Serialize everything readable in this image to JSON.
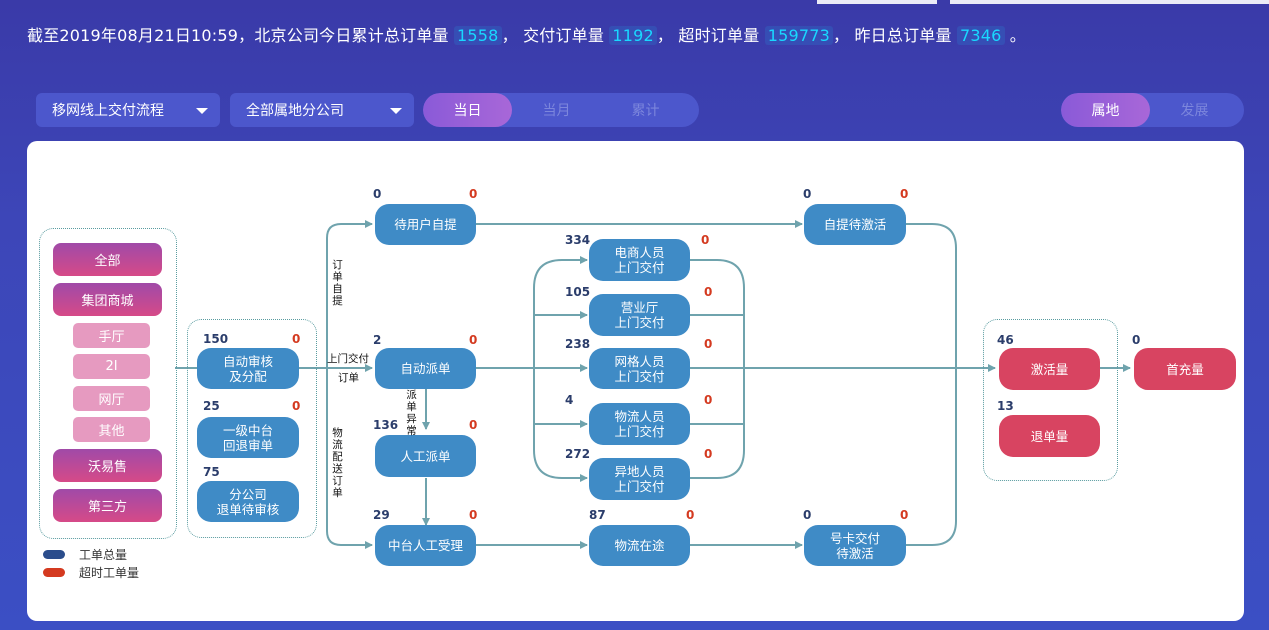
{
  "summary": {
    "prefix": "截至2019年08月21日10:59，北京公司今日累计总订单量",
    "total": "1558",
    "sep1": "，  交付订单量",
    "delivered": "1192",
    "sep2": "，  超时订单量",
    "overtime": "159773",
    "sep3": "，  昨日总订单量",
    "yesterday": "7346",
    "suffix": "。"
  },
  "filters": {
    "process": "移网线上交付流程",
    "branch": "全部属地分公司"
  },
  "time_tabs": [
    "当日",
    "当月",
    "累计"
  ],
  "view_tabs": [
    "属地",
    "发展"
  ],
  "channels": {
    "all": "全部",
    "group_mall": "集团商城",
    "sub": [
      "手厅",
      "2I",
      "网厅",
      "其他"
    ],
    "woyishou": "沃易售",
    "third": "第三方"
  },
  "nodes": {
    "auto_review": {
      "l1": "自动审核",
      "l2": "及分配",
      "count": "150",
      "over": "0"
    },
    "first_return": {
      "l1": "一级中台",
      "l2": "回退审单",
      "count": "25",
      "over": "0"
    },
    "branch_return": {
      "l1": "分公司",
      "l2": "退单待审核",
      "count": "75"
    },
    "pickup_wait": {
      "label": "待用户自提",
      "count": "0",
      "over": "0"
    },
    "auto_dispatch": {
      "label": "自动派单",
      "count": "2",
      "over": "0"
    },
    "manual_dispatch": {
      "label": "人工派单",
      "count": "136",
      "over": "0"
    },
    "center_accept": {
      "label": "中台人工受理",
      "count": "29",
      "over": "0"
    },
    "ecom": {
      "l1": "电商人员",
      "l2": "上门交付",
      "count": "334",
      "over": "0"
    },
    "hall": {
      "l1": "营业厅",
      "l2": "上门交付",
      "count": "105",
      "over": "0"
    },
    "grid": {
      "l1": "网格人员",
      "l2": "上门交付",
      "count": "238",
      "over": "0"
    },
    "logistics_staff": {
      "l1": "物流人员",
      "l2": "上门交付",
      "count": "4",
      "over": "0"
    },
    "remote": {
      "l1": "异地人员",
      "l2": "上门交付",
      "count": "272",
      "over": "0"
    },
    "in_transit": {
      "label": "物流在途",
      "count": "87",
      "over": "0"
    },
    "pickup_activate": {
      "label": "自提待激活",
      "count": "0",
      "over": "0"
    },
    "card_delivery": {
      "l1": "号卡交付",
      "l2": "待激活",
      "count": "0",
      "over": "0"
    },
    "activation": {
      "label": "激活量",
      "count": "46"
    },
    "return": {
      "label": "退单量",
      "count": "13"
    },
    "first_charge": {
      "label": "首充量",
      "count": "0"
    }
  },
  "edge_labels": {
    "order_pickup": "订单自提",
    "door_delivery_1": "上门交付",
    "door_delivery_2": "订单",
    "dispatch_abnormal": "派单异常",
    "logistics_order": "物流配送订单"
  },
  "legend": {
    "total": "工单总量",
    "overtime": "超时工单量"
  },
  "colors": {
    "node": "#3f8bc6",
    "result": "#d84461",
    "count": "#2b3d6b",
    "overtime": "#d43a20",
    "line": "#6fa3ad",
    "accent": "#19d8ff"
  }
}
